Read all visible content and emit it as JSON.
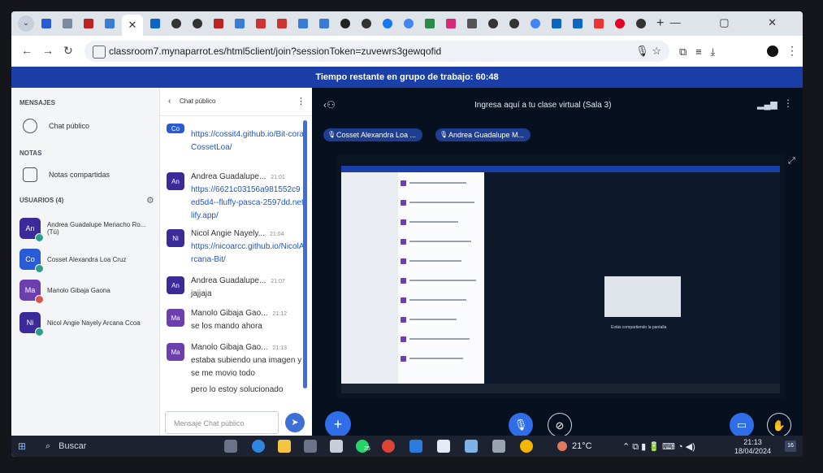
{
  "browser": {
    "url": "classroom7.mynaparrot.es/html5client/join?sessionToken=zuvewrs3gewqofid",
    "tab_close": "✕",
    "new_tab": "+",
    "window_controls": "—   ▢   ✕"
  },
  "banner": {
    "text": "Tiempo restante en grupo de trabajo: 60:48"
  },
  "sidebar": {
    "messages_title": "MENSAJES",
    "public_chat_label": "Chat público",
    "notes_title": "NOTAS",
    "shared_notes_label": "Notas compartidas",
    "users_title": "USUARIOS (4)",
    "users": [
      {
        "initials": "An",
        "name": "Andrea Guadalupe Menacho Ro... (Tú)",
        "color": "#3a2a9a"
      },
      {
        "initials": "Co",
        "name": "Cosset Alexandra Loa Cruz",
        "color": "#2a5bd7"
      },
      {
        "initials": "Ma",
        "name": "Manolo Gibaja Gaona",
        "color": "#6c3fb0"
      },
      {
        "initials": "Ni",
        "name": "Nicol Angie Nayely Arcana Ccoa",
        "color": "#3a2a9a"
      }
    ]
  },
  "chat": {
    "title": "Chat público",
    "input_placeholder": "Mensaje Chat público",
    "messages": [
      {
        "initials": "Co",
        "name": "",
        "time": "",
        "text": "https://cossit4.github.io/Bit-coraCossetLoa/",
        "link": true
      },
      {
        "initials": "An",
        "name": "Andrea Guadalupe...",
        "time": "21:01",
        "text": "https://6621c03156a981552c9ed5d4--fluffy-pasca-2597dd.netlify.app/",
        "link": true
      },
      {
        "initials": "Ni",
        "name": "Nicol Angie Nayely...",
        "time": "21:04",
        "text": "https://nicoarcc.github.io/NicolArcana-Bit/",
        "link": true
      },
      {
        "initials": "An",
        "name": "Andrea Guadalupe...",
        "time": "21:07",
        "text": "jajjaja",
        "link": false
      },
      {
        "initials": "Ma",
        "name": "Manolo Gibaja Gao...",
        "time": "21:12",
        "text": "se los mando ahora",
        "link": false
      },
      {
        "initials": "Ma",
        "name": "Manolo Gibaja Gao...",
        "time": "21:13",
        "text": "estaba subiendo una imagen y se me movio todo",
        "text2": "pero lo estoy solucionado",
        "link": false
      }
    ]
  },
  "main": {
    "room_title": "Ingresa aquí a tu clase virtual (Sala 3)",
    "presenters": [
      "Cosset Alexandra Loa ...",
      "Andrea Guadalupe M..."
    ],
    "nested_label": "Estás compartiendo la pantalla"
  },
  "taskbar": {
    "search_label": "Buscar",
    "weather": "21°C",
    "time": "21:13",
    "date": "18/04/2024",
    "notifications": "16",
    "whatsapp_badge": "25"
  },
  "colors": {
    "accent": "#2f6ee8",
    "banner": "#1b3fa8",
    "link": "#1a57c6"
  }
}
